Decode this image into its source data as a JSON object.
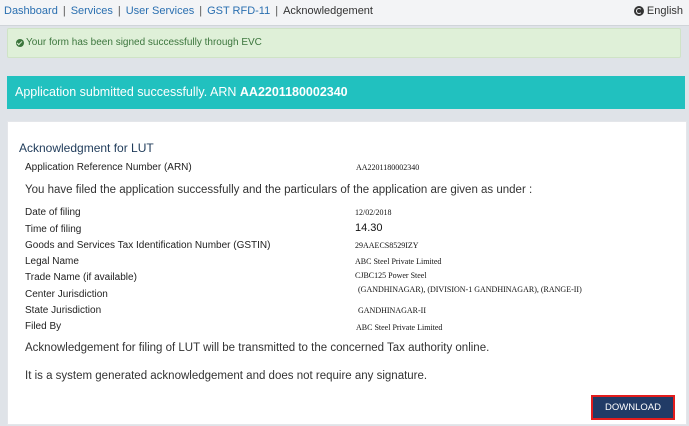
{
  "breadcrumb": {
    "items": [
      "Dashboard",
      "Services",
      "User Services",
      "GST RFD-11"
    ],
    "current": "Acknowledgement"
  },
  "language": {
    "label": "English",
    "icon": "globe-icon"
  },
  "alert": {
    "message": "Your form has been signed successfully through EVC",
    "icon": "check-circle-icon"
  },
  "banner": {
    "prefix": "Application submitted successfully. ARN",
    "arn": "AA2201180002340",
    "color": "#21c1bf"
  },
  "ack": {
    "title": "Acknowledgment for LUT",
    "arn_label": "Application Reference Number (ARN)",
    "arn_value": "AA2201180002340",
    "intro": "You have filed the application successfully and the particulars of the application are given as under :",
    "rows": [
      {
        "label": "Date of filing",
        "value": "12/02/2018"
      },
      {
        "label": "Time of filing",
        "value": "14.30"
      },
      {
        "label": "Goods and Services Tax Identification Number (GSTIN)",
        "value": "29AAECS8529IZY"
      },
      {
        "label": "Legal Name",
        "value": "ABC Steel Private Limited"
      },
      {
        "label": "Trade Name (if available)",
        "value": "CJBC125 Power Steel"
      },
      {
        "label": "Center Jurisdiction",
        "value": "(GANDHINAGAR), (DIVISION-1 GANDHINAGAR), (RANGE-II)"
      },
      {
        "label": "State Jurisdiction",
        "value": "GANDHINAGAR-II"
      },
      {
        "label": "Filed By",
        "value": "ABC Steel Private Limited"
      }
    ],
    "note1": "Acknowledgement for filing of LUT will be transmitted to the concerned Tax authority online.",
    "note2": "It is a system generated acknowledgement and does not require any signature."
  },
  "download_button": "DOWNLOAD"
}
